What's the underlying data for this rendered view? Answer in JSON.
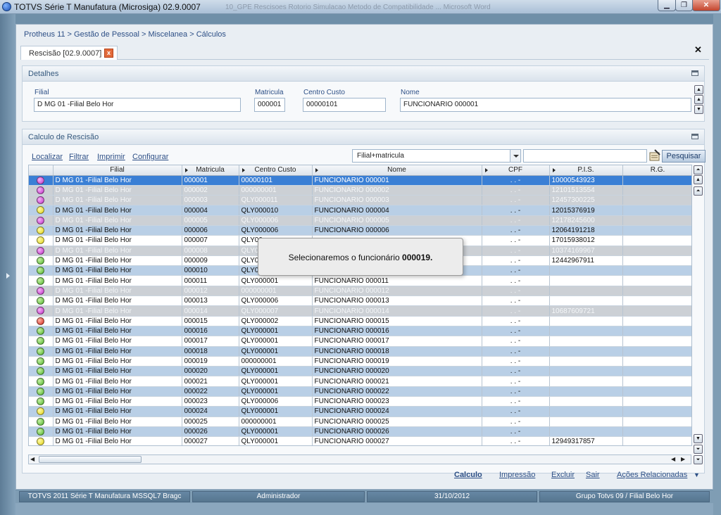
{
  "window": {
    "title": "TOTVS Série T Manufatura (Microsiga) 02.9.0007",
    "background_title": "10_GPE Rescisoes Rotorio Simulacao Metodo de Compatibilidade ... Microsoft Word",
    "min_glyph": "▁",
    "max_glyph": "❐",
    "close_glyph": "✕"
  },
  "breadcrumb": "Protheus 11 > Gestão de Pessoal > Miscelanea > Cálculos",
  "tab": {
    "label": "Rescisão [02.9.0007]",
    "close_glyph": "x"
  },
  "page_close_glyph": "✕",
  "detalhes": {
    "title": "Detalhes",
    "fields": {
      "filial": {
        "label": "Filial",
        "value": "D MG 01 -Filial Belo Hor"
      },
      "matricula": {
        "label": "Matricula",
        "value": "000001"
      },
      "centro_custo": {
        "label": "Centro Custo",
        "value": "00000101"
      },
      "nome": {
        "label": "Nome",
        "value": "FUNCIONARIO 000001"
      }
    }
  },
  "calculo": {
    "title": "Calculo de Rescisão",
    "toolbar": {
      "localizar": "Localizar",
      "filtrar": "Filtrar",
      "imprimir": "Imprimir",
      "configurar": "Configurar"
    },
    "order_select": "Filial+matricula",
    "search_value": "",
    "search_button": "Pesquisar",
    "columns": [
      "Filial",
      "Matricula",
      "Centro Custo",
      "Nome",
      "CPF",
      "P.I.S.",
      "R.G."
    ],
    "rows": [
      {
        "status": "magenta",
        "style": "sel",
        "filial": "D MG 01 -Filial Belo Hor",
        "matricula": "000001",
        "centro_custo": "00000101",
        "nome": "FUNCIONARIO 000001",
        "cpf": ". . -",
        "pis": "10000543923"
      },
      {
        "status": "magenta",
        "style": "grey",
        "filial": "D MG 01 -Filial Belo Hor",
        "matricula": "000002",
        "centro_custo": "000000001",
        "nome": "FUNCIONARIO 000002",
        "cpf": ". . -",
        "pis": "12101513554"
      },
      {
        "status": "magenta",
        "style": "grey",
        "filial": "D MG 01 -Filial Belo Hor",
        "matricula": "000003",
        "centro_custo": "QLY000011",
        "nome": "FUNCIONARIO 000003",
        "cpf": ". . -",
        "pis": "12457300225"
      },
      {
        "status": "yellow",
        "style": "blue",
        "filial": "D MG 01 -Filial Belo Hor",
        "matricula": "000004",
        "centro_custo": "QLY000010",
        "nome": "FUNCIONARIO 000004",
        "cpf": ". . -",
        "pis": "12015376919"
      },
      {
        "status": "magenta",
        "style": "grey",
        "filial": "D MG 01 -Filial Belo Hor",
        "matricula": "000005",
        "centro_custo": "QLY000006",
        "nome": "FUNCIONARIO 000005",
        "cpf": ". . -",
        "pis": "12178245600"
      },
      {
        "status": "yellow",
        "style": "blue",
        "filial": "D MG 01 -Filial Belo Hor",
        "matricula": "000006",
        "centro_custo": "QLY000006",
        "nome": "FUNCIONARIO 000006",
        "cpf": ". . -",
        "pis": "12064191218"
      },
      {
        "status": "yellow",
        "style": "white",
        "filial": "D MG 01 -Filial Belo Hor",
        "matricula": "000007",
        "centro_custo": "QLY00",
        "nome": "",
        "cpf": ". . -",
        "pis": "17015938012"
      },
      {
        "status": "magenta",
        "style": "grey",
        "filial": "D MG 01 -Filial Belo Hor",
        "matricula": "000008",
        "centro_custo": "QLY00",
        "nome": "",
        "cpf": ". . -",
        "pis": "10374169967"
      },
      {
        "status": "green",
        "style": "white",
        "filial": "D MG 01 -Filial Belo Hor",
        "matricula": "000009",
        "centro_custo": "QLY00",
        "nome": "",
        "cpf": ". . -",
        "pis": "12442967911"
      },
      {
        "status": "green",
        "style": "blue",
        "filial": "D MG 01 -Filial Belo Hor",
        "matricula": "000010",
        "centro_custo": "QLY00",
        "nome": "",
        "cpf": ". . -",
        "pis": ""
      },
      {
        "status": "green",
        "style": "white",
        "filial": "D MG 01 -Filial Belo Hor",
        "matricula": "000011",
        "centro_custo": "QLY000001",
        "nome": "FUNCIONARIO 000011",
        "cpf": ". . -",
        "pis": ""
      },
      {
        "status": "magenta",
        "style": "grey",
        "filial": "D MG 01 -Filial Belo Hor",
        "matricula": "000012",
        "centro_custo": "000000001",
        "nome": "FUNCIONARIO 000012",
        "cpf": ". . -",
        "pis": ""
      },
      {
        "status": "green",
        "style": "white",
        "filial": "D MG 01 -Filial Belo Hor",
        "matricula": "000013",
        "centro_custo": "QLY000006",
        "nome": "FUNCIONARIO 000013",
        "cpf": ". . -",
        "pis": ""
      },
      {
        "status": "magenta",
        "style": "grey",
        "filial": "D MG 01 -Filial Belo Hor",
        "matricula": "000014",
        "centro_custo": "QLY000007",
        "nome": "FUNCIONARIO 000014",
        "cpf": ". . -",
        "pis": "10687609721"
      },
      {
        "status": "red",
        "style": "white",
        "filial": "D MG 01 -Filial Belo Hor",
        "matricula": "000015",
        "centro_custo": "QLY000002",
        "nome": "FUNCIONARIO 000015",
        "cpf": ". . -",
        "pis": ""
      },
      {
        "status": "green",
        "style": "blue",
        "filial": "D MG 01 -Filial Belo Hor",
        "matricula": "000016",
        "centro_custo": "QLY000001",
        "nome": "FUNCIONARIO 000016",
        "cpf": ". . -",
        "pis": ""
      },
      {
        "status": "green",
        "style": "white",
        "filial": "D MG 01 -Filial Belo Hor",
        "matricula": "000017",
        "centro_custo": "QLY000001",
        "nome": "FUNCIONARIO 000017",
        "cpf": ". . -",
        "pis": ""
      },
      {
        "status": "green",
        "style": "blue",
        "filial": "D MG 01 -Filial Belo Hor",
        "matricula": "000018",
        "centro_custo": "QLY000001",
        "nome": "FUNCIONARIO 000018",
        "cpf": ". . -",
        "pis": ""
      },
      {
        "status": "green",
        "style": "white",
        "filial": "D MG 01 -Filial Belo Hor",
        "matricula": "000019",
        "centro_custo": "000000001",
        "nome": "FUNCIONARIO 000019",
        "cpf": ". . -",
        "pis": ""
      },
      {
        "status": "green",
        "style": "blue",
        "filial": "D MG 01 -Filial Belo Hor",
        "matricula": "000020",
        "centro_custo": "QLY000001",
        "nome": "FUNCIONARIO 000020",
        "cpf": ". . -",
        "pis": ""
      },
      {
        "status": "green",
        "style": "white",
        "filial": "D MG 01 -Filial Belo Hor",
        "matricula": "000021",
        "centro_custo": "QLY000001",
        "nome": "FUNCIONARIO 000021",
        "cpf": ". . -",
        "pis": ""
      },
      {
        "status": "green",
        "style": "blue",
        "filial": "D MG 01 -Filial Belo Hor",
        "matricula": "000022",
        "centro_custo": "QLY000001",
        "nome": "FUNCIONARIO 000022",
        "cpf": ". . -",
        "pis": ""
      },
      {
        "status": "green",
        "style": "white",
        "filial": "D MG 01 -Filial Belo Hor",
        "matricula": "000023",
        "centro_custo": "QLY000006",
        "nome": "FUNCIONARIO 000023",
        "cpf": ". . -",
        "pis": ""
      },
      {
        "status": "yellow",
        "style": "blue",
        "filial": "D MG 01 -Filial Belo Hor",
        "matricula": "000024",
        "centro_custo": "QLY000001",
        "nome": "FUNCIONARIO 000024",
        "cpf": ". . -",
        "pis": ""
      },
      {
        "status": "green",
        "style": "white",
        "filial": "D MG 01 -Filial Belo Hor",
        "matricula": "000025",
        "centro_custo": "000000001",
        "nome": "FUNCIONARIO 000025",
        "cpf": ". . -",
        "pis": ""
      },
      {
        "status": "green",
        "style": "blue",
        "filial": "D MG 01 -Filial Belo Hor",
        "matricula": "000026",
        "centro_custo": "QLY000001",
        "nome": "FUNCIONARIO 000026",
        "cpf": ". . -",
        "pis": ""
      },
      {
        "status": "yellow",
        "style": "white",
        "filial": "D MG 01 -Filial Belo Hor",
        "matricula": "000027",
        "centro_custo": "QLY000001",
        "nome": "FUNCIONARIO 000027",
        "cpf": ". . -",
        "pis": "12949317857"
      }
    ],
    "actions": {
      "calculo": "Calculo",
      "impressao": "Impressão",
      "excluir": "Excluir",
      "sair": "Sair",
      "acoes": "Ações Relacionadas"
    }
  },
  "tooltip": {
    "text": "Selecionaremos o funcionário ",
    "bold": "000019."
  },
  "statusbar": {
    "product": "TOTVS 2011 Série T Manufatura MSSQL7 Bragc",
    "user": "Administrador",
    "date": "31/10/2012",
    "company": "Grupo Totvs 09 / Filial Belo Hor"
  },
  "colors": {
    "selected_row": "#3a7fd5",
    "blue_row": "#b9cfe6",
    "grey_row": "#ccd0d5",
    "link": "#2d4f86"
  }
}
